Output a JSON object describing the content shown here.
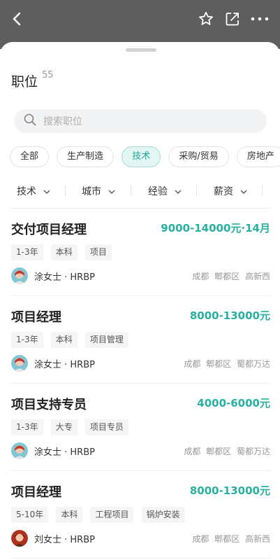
{
  "header": {
    "icons": [
      "back-icon",
      "star-icon",
      "share-icon",
      "more-icon"
    ]
  },
  "sheet": {
    "title": "职位",
    "count": "55"
  },
  "search": {
    "placeholder": "搜索职位"
  },
  "categories": [
    {
      "label": "全部",
      "active": false
    },
    {
      "label": "生产制造",
      "active": false
    },
    {
      "label": "技术",
      "active": true
    },
    {
      "label": "采购/贸易",
      "active": false
    },
    {
      "label": "房地产",
      "active": false
    }
  ],
  "filters": [
    {
      "label": "技术"
    },
    {
      "label": "城市"
    },
    {
      "label": "经验"
    },
    {
      "label": "薪资"
    }
  ],
  "jobs": [
    {
      "title": "交付项目经理",
      "salary": "9000-14000元·14月",
      "tags": [
        "1-3年",
        "本科",
        "项目"
      ],
      "recruiter": "涂女士 · HRBP",
      "location": "成都  郫都区  高新西"
    },
    {
      "title": "项目经理",
      "salary": "8000-13000元",
      "tags": [
        "1-3年",
        "本科",
        "项目管理"
      ],
      "recruiter": "涂女士 · HRBP",
      "location": "成都  郫都区  蜀都万达"
    },
    {
      "title": "项目支持专员",
      "salary": "4000-6000元",
      "tags": [
        "1-3年",
        "大专",
        "项目专员"
      ],
      "recruiter": "涂女士 · HRBP",
      "location": "成都  郫都区  蜀都万达"
    },
    {
      "title": "项目经理",
      "salary": "8000-13000元",
      "tags": [
        "5-10年",
        "本科",
        "工程项目",
        "锅炉安装"
      ],
      "recruiter": "刘女士 · HRBP",
      "location": "成都  郫都区  高新西"
    }
  ],
  "colors": {
    "accent": "#28b0a2",
    "topbar": "#5e5e5e"
  }
}
